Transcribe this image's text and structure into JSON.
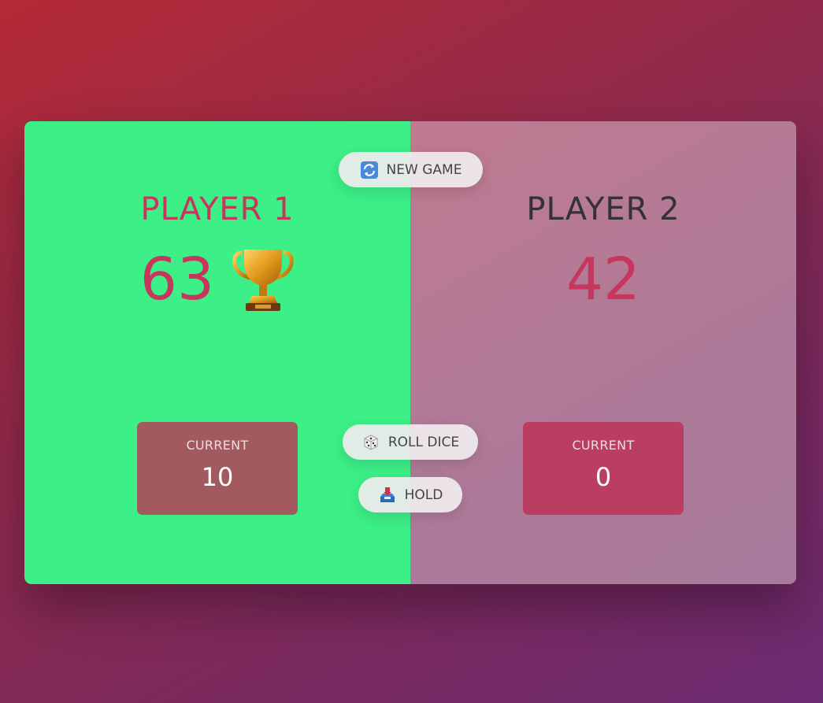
{
  "players": [
    {
      "name": "PLAYER 1",
      "score": "63",
      "current_label": "CURRENT",
      "current_score": "10",
      "winner": true,
      "badge_icon": "trophy-icon"
    },
    {
      "name": "PLAYER 2",
      "score": "42",
      "current_label": "CURRENT",
      "current_score": "0",
      "winner": false
    }
  ],
  "buttons": {
    "new_game": {
      "label": "NEW GAME",
      "icon": "refresh-icon"
    },
    "roll_dice": {
      "label": "ROLL DICE",
      "icon": "dice-icon"
    },
    "hold": {
      "label": "HOLD",
      "icon": "inbox-tray-icon"
    }
  },
  "colors": {
    "winner_panel": "#3cef87",
    "score_text": "#c7365c",
    "current_box_p1": "#a25a5e",
    "current_box_p2": "#ba3d62"
  }
}
